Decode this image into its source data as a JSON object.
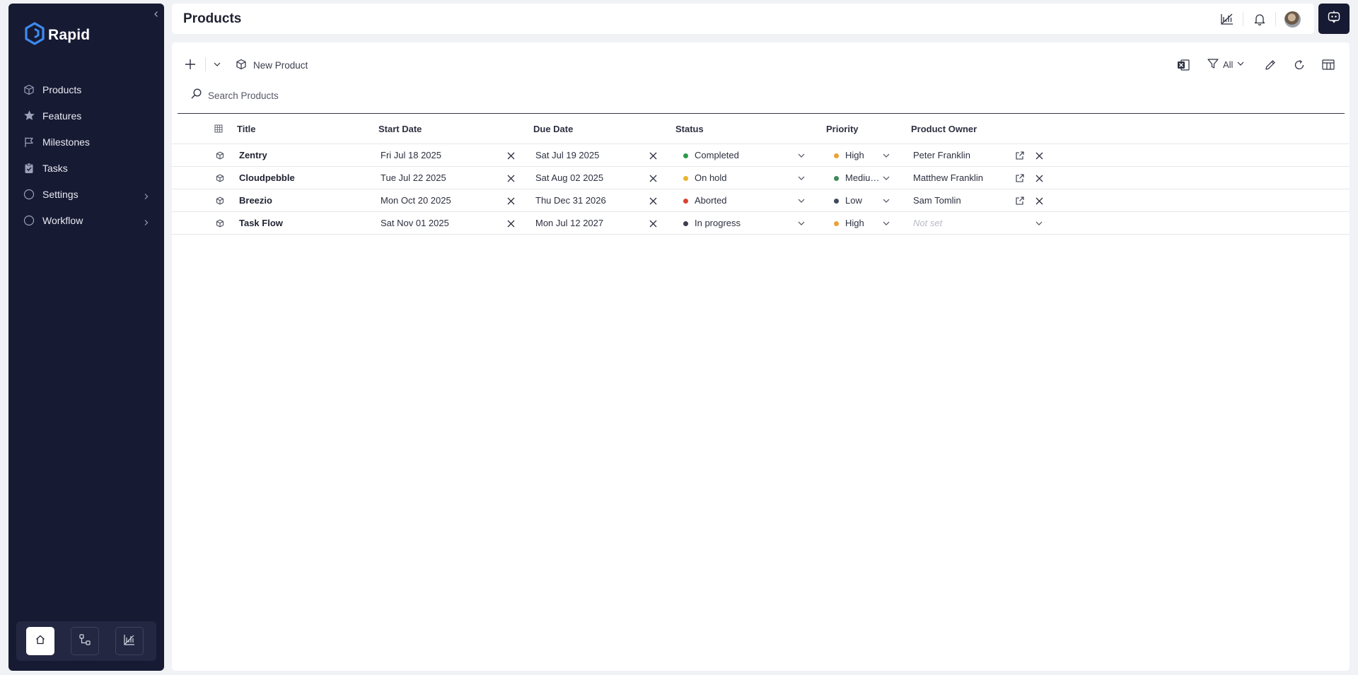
{
  "app": {
    "name": "Rapid"
  },
  "sidebar": {
    "items": [
      {
        "label": "Products",
        "icon": "box-icon"
      },
      {
        "label": "Features",
        "icon": "star-icon"
      },
      {
        "label": "Milestones",
        "icon": "flag-icon"
      },
      {
        "label": "Tasks",
        "icon": "clipboard-check-icon"
      },
      {
        "label": "Settings",
        "icon": "circle-icon",
        "has_children": true
      },
      {
        "label": "Workflow",
        "icon": "circle-icon",
        "has_children": true
      }
    ],
    "bottom_buttons": [
      "home-icon",
      "workflow-diagram-icon",
      "chart-icon"
    ]
  },
  "header": {
    "title": "Products"
  },
  "toolbar": {
    "new_label": "New Product",
    "filter_label": "All",
    "search_placeholder": "Search Products"
  },
  "table": {
    "columns": [
      "Title",
      "Start Date",
      "Due Date",
      "Status",
      "Priority",
      "Product Owner"
    ],
    "rows": [
      {
        "title": "Zentry",
        "start": "Fri Jul 18 2025",
        "due": "Sat Jul 19 2025",
        "status": "Completed",
        "status_color": "#2e9a4a",
        "priority": "High",
        "priority_color": "#e9a23b",
        "owner": "Peter Franklin"
      },
      {
        "title": "Cloudpebble",
        "start": "Tue Jul 22 2025",
        "due": "Sat Aug 02 2025",
        "status": "On hold",
        "status_color": "#e8b52e",
        "priority": "Mediu…",
        "priority_color": "#3d8a5a",
        "owner": "Matthew Franklin"
      },
      {
        "title": "Breezio",
        "start": "Mon Oct 20 2025",
        "due": "Thu Dec 31 2026",
        "status": "Aborted",
        "status_color": "#d9432f",
        "priority": "Low",
        "priority_color": "#3e4a5c",
        "owner": "Sam Tomlin"
      },
      {
        "title": "Task Flow",
        "start": "Sat Nov 01 2025",
        "due": "Mon Jul 12 2027",
        "status": "In progress",
        "status_color": "#3c3f4c",
        "priority": "High",
        "priority_color": "#e9a23b",
        "owner": "Not set",
        "owner_unset": true
      }
    ]
  },
  "colors": {
    "sidebar_bg": "#171a33",
    "page_bg": "#f1f2f6"
  }
}
